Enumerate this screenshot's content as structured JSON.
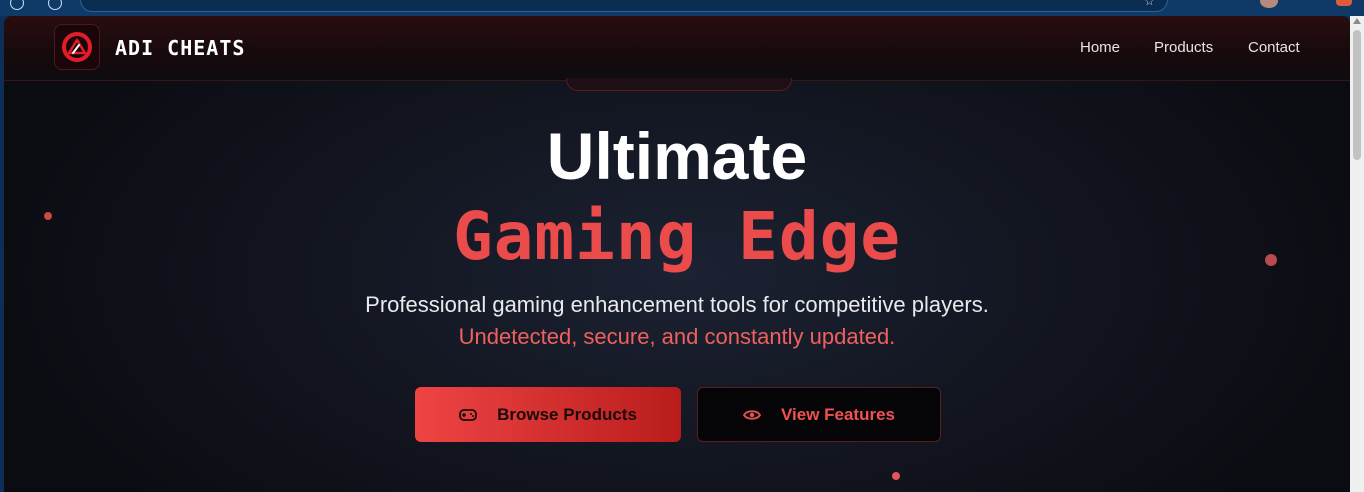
{
  "site": {
    "brand": "ADI CHEATS",
    "nav": {
      "home": "Home",
      "products": "Products",
      "contact": "Contact"
    }
  },
  "hero": {
    "title_line1": "Ultimate",
    "title_line2": "Gaming Edge",
    "subtitle_line1": "Professional gaming enhancement tools for competitive players.",
    "subtitle_line2": "Undetected, secure, and constantly updated.",
    "primary_button": "Browse Products",
    "secondary_button": "View Features"
  },
  "icons": {
    "logo": "logo-icon",
    "primary_button": "gamepad-icon",
    "secondary_button": "eye-icon"
  },
  "colors": {
    "accent": "#ef4444",
    "accent_dark": "#b91c1c",
    "background": "#12151f"
  }
}
